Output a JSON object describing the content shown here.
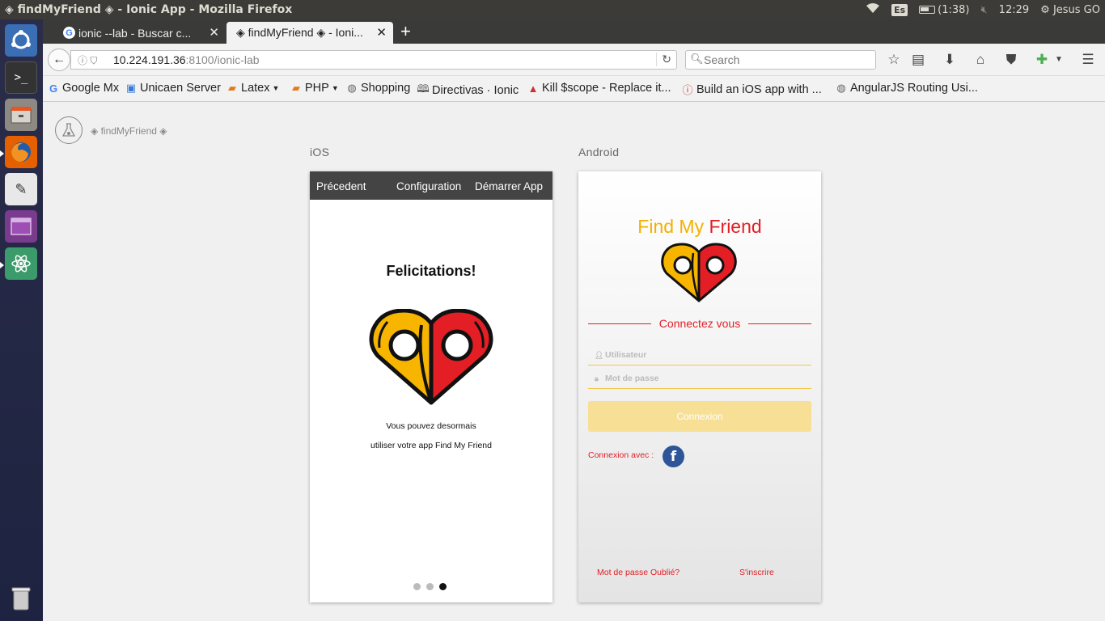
{
  "window": {
    "title": "◈ findMyFriend ◈ - Ionic App - Mozilla Firefox"
  },
  "panel": {
    "keyboard": "Es",
    "battery": "(1:38)",
    "time": "12:29",
    "user": "Jesus GO"
  },
  "tabs": [
    {
      "label": "ionic --lab - Buscar c...",
      "favicon": "G"
    },
    {
      "label": "◈ findMyFriend ◈ - Ioni...",
      "favicon": "◈"
    }
  ],
  "url": {
    "host": "10.224.191.36",
    "rest": ":8100/ionic-lab"
  },
  "search": {
    "placeholder": "Search"
  },
  "bookmarks": [
    {
      "label": "Google Mx",
      "icon": "google-icon"
    },
    {
      "label": "Unicaen Server",
      "icon": "server-icon"
    },
    {
      "label": "Latex",
      "icon": "folder-icon",
      "dropdown": true
    },
    {
      "label": "PHP",
      "icon": "folder-icon",
      "dropdown": true
    },
    {
      "label": "Shopping",
      "icon": "globe-icon"
    },
    {
      "label": "Directivas · Ionic",
      "icon": "book-icon"
    },
    {
      "label": "Kill $scope - Replace it...",
      "icon": "warning-icon"
    },
    {
      "label": "Build an iOS app with ...",
      "icon": "info-icon"
    },
    {
      "label": "AngularJS Routing Usi...",
      "icon": "globe-icon"
    }
  ],
  "lab": {
    "title": "◈ findMyFriend ◈",
    "ios_label": "iOS",
    "android_label": "Android"
  },
  "ios": {
    "header_left": "Précedent",
    "header_mid": "Configuration",
    "header_right": "Démarrer App",
    "title": "Felicitations!",
    "line1": "Vous pouvez desormais",
    "line2": "utiliser votre app Find My Friend",
    "dots_count": 3,
    "active_dot": 3
  },
  "android": {
    "brand_yellow": "Find My",
    "brand_red": "Friend",
    "connect": "Connectez vous",
    "user_placeholder": "Utilisateur",
    "pass_placeholder": "Mot de passe",
    "login": "Connexion",
    "social": "Connexion avec :",
    "fb": "f",
    "forgot": "Mot de passe Oublié?",
    "signup": "S'inscrire"
  },
  "colors": {
    "yellow": "#f4b000",
    "red": "#e31e24",
    "facebook": "#2d5597"
  }
}
